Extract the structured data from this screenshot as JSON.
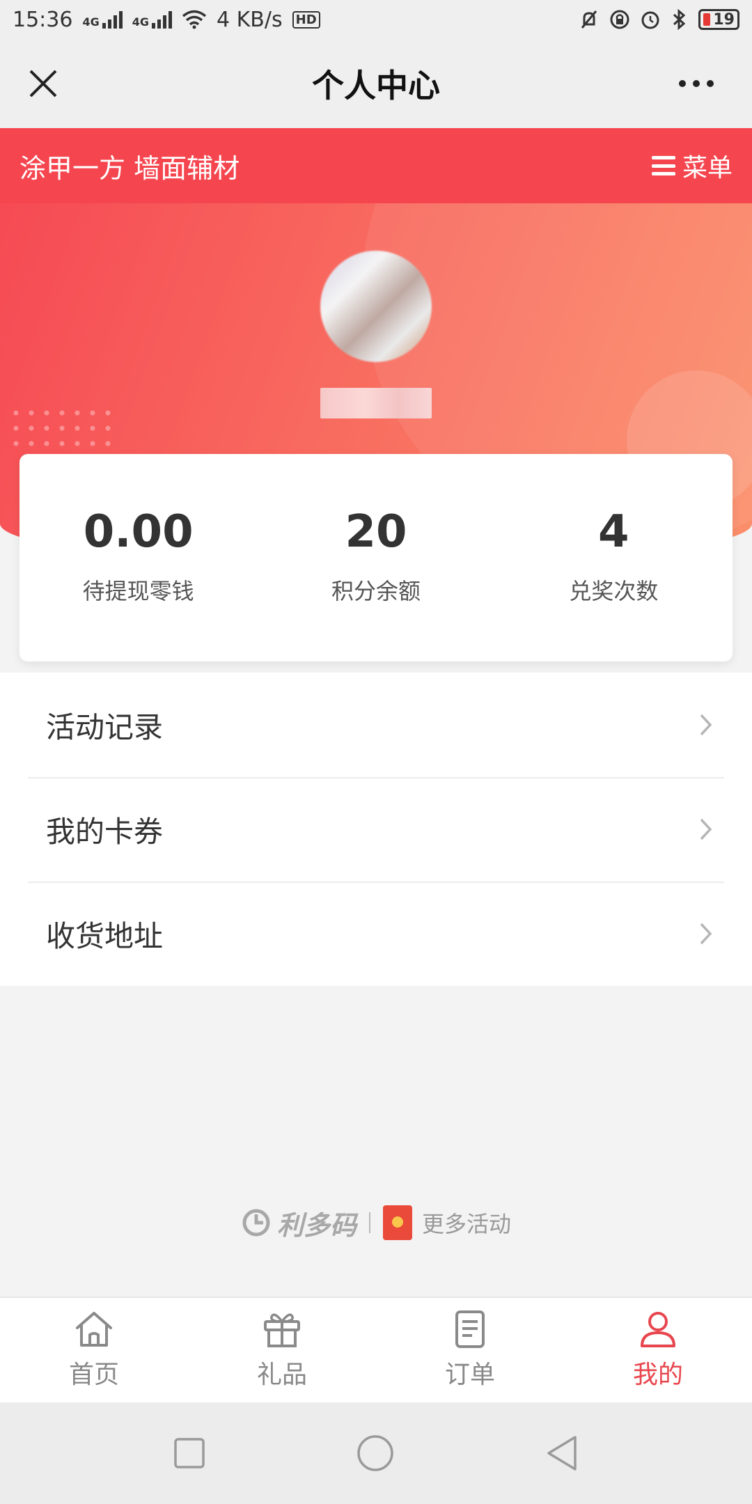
{
  "status_bar": {
    "time": "15:36",
    "net1": "4G",
    "net2": "4G",
    "speed": "4 KB/s",
    "hd": "HD",
    "battery": "19"
  },
  "title_bar": {
    "title": "个人中心"
  },
  "brand_bar": {
    "title": "涂甲一方 墙面辅材",
    "menu_label": "菜单"
  },
  "stats": [
    {
      "value": "0.00",
      "label": "待提现零钱"
    },
    {
      "value": "20",
      "label": "积分余额"
    },
    {
      "value": "4",
      "label": "兑奖次数"
    }
  ],
  "menu_items": [
    {
      "label": "活动记录"
    },
    {
      "label": "我的卡券"
    },
    {
      "label": "收货地址"
    }
  ],
  "footer": {
    "brand": "利多码",
    "more": "更多活动"
  },
  "tabs": [
    {
      "label": "首页",
      "icon": "home-icon",
      "active": false
    },
    {
      "label": "礼品",
      "icon": "gift-icon",
      "active": false
    },
    {
      "label": "订单",
      "icon": "order-icon",
      "active": false
    },
    {
      "label": "我的",
      "icon": "user-icon",
      "active": true
    }
  ],
  "colors": {
    "brand_red": "#f5464f",
    "active_tab": "#e8464e"
  }
}
